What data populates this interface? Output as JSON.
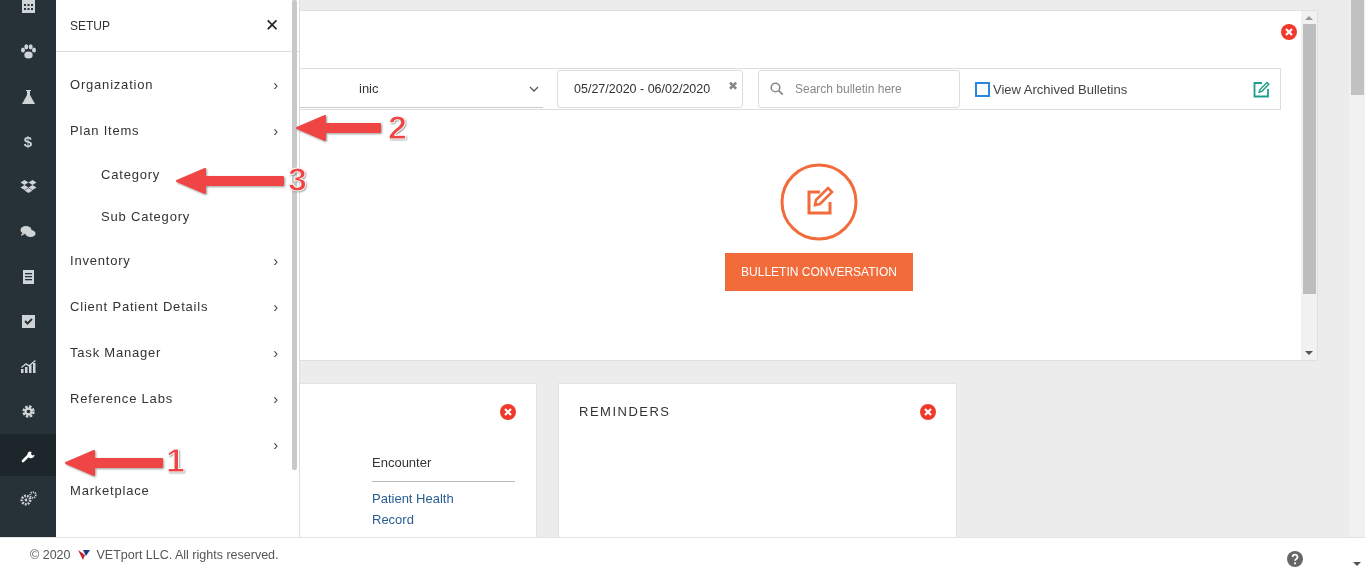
{
  "rail": [
    {
      "selected": false
    },
    {
      "selected": false
    },
    {
      "selected": false
    },
    {
      "selected": false,
      "glyph": "$"
    },
    {
      "selected": false
    },
    {
      "selected": false
    },
    {
      "selected": false
    },
    {
      "selected": false
    },
    {
      "selected": false
    },
    {
      "selected": false
    },
    {
      "selected": true
    },
    {
      "selected": false
    }
  ],
  "bulletin": {
    "clinic_select": "inic",
    "date_range": "05/27/2020 - 06/02/2020",
    "date_clear": "✖",
    "search_placeholder": "Search bulletin here",
    "archived": {
      "label": "View Archived Bulletins",
      "checked": false
    },
    "button": "BULLETIN CONVERSATION"
  },
  "left_card": {
    "links": [
      {
        "label": "Encounter",
        "kind": "plain"
      },
      {
        "label": "Patient Health Record",
        "kind": "link"
      }
    ]
  },
  "reminders": {
    "title": "REMINDERS"
  },
  "setup_menu": {
    "title": "SETUP",
    "close": "✕",
    "items": [
      {
        "label": "Organization",
        "arrow": "›"
      },
      {
        "label": "Plan Items",
        "arrow": "›",
        "children": [
          {
            "label": "Category"
          },
          {
            "label": "Sub Category"
          }
        ]
      },
      {
        "label": "Inventory",
        "arrow": "›"
      },
      {
        "label": "Client Patient Details",
        "arrow": "›"
      },
      {
        "label": "Task Manager",
        "arrow": "›"
      },
      {
        "label": "Reference Labs",
        "arrow": "›"
      },
      {
        "arrow": "›"
      },
      {
        "label": "Marketplace"
      }
    ]
  },
  "annotations": [
    "1",
    "2",
    "3"
  ],
  "footer": {
    "text": "© 2020",
    "company": "VETport LLC. All rights reserved."
  }
}
